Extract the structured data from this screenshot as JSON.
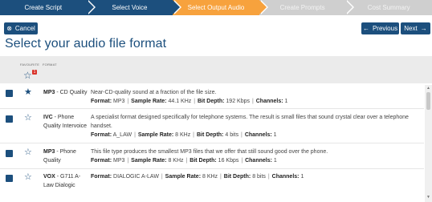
{
  "wizard": {
    "steps": [
      {
        "label": "Create Script",
        "state": "done"
      },
      {
        "label": "Select Voice",
        "state": "done"
      },
      {
        "label": "Select Output Audio",
        "state": "active"
      },
      {
        "label": "Create Prompts",
        "state": "todo"
      },
      {
        "label": "Cost Summary",
        "state": "todo"
      }
    ]
  },
  "toolbar": {
    "cancel_label": "Cancel",
    "cancel_icon": "circle-x-icon",
    "previous_label": "Previous",
    "previous_icon": "arrow-left-icon",
    "next_label": "Next",
    "next_icon": "arrow-right-icon"
  },
  "page": {
    "title": "Select your audio file format"
  },
  "table": {
    "col_favourite": "FAVOURITE",
    "col_format": "FORMAT",
    "filter_badge": "1",
    "rows": [
      {
        "name": "MP3",
        "subtitle": " - CD Quality",
        "favourite": true,
        "description": "Near-CD-quality sound at a fraction of the file size.",
        "format_label": "Format:",
        "format": "MP3",
        "rate_label": "Sample Rate:",
        "rate": "44.1 KHz",
        "depth_label": "Bit Depth:",
        "depth": "192 Kbps",
        "channels_label": "Channels:",
        "channels": "1"
      },
      {
        "name": "IVC",
        "subtitle": " - Phone Quality Intervoice",
        "favourite": false,
        "description": "A specialist format designed specifically for telephone systems. The result is small files that sound crystal clear over a telephone handset.",
        "format_label": "Format:",
        "format": "A_LAW",
        "rate_label": "Sample Rate:",
        "rate": "8 KHz",
        "depth_label": "Bit Depth:",
        "depth": "4 bits",
        "channels_label": "Channels:",
        "channels": "1"
      },
      {
        "name": "MP3",
        "subtitle": " - Phone Quality",
        "favourite": false,
        "description": "This file type produces the smallest MP3 files that we offer that still sound good over the phone.",
        "format_label": "Format:",
        "format": "MP3",
        "rate_label": "Sample Rate:",
        "rate": "8 KHz",
        "depth_label": "Bit Depth:",
        "depth": "16 Kbps",
        "channels_label": "Channels:",
        "channels": "1"
      },
      {
        "name": "VOX",
        "subtitle": " - G711 A-Law Dialogic",
        "favourite": false,
        "description": "",
        "format_label": "Format:",
        "format": "DIALOGIC A-LAW",
        "rate_label": "Sample Rate:",
        "rate": "8 KHz",
        "depth_label": "Bit Depth:",
        "depth": "8 bits",
        "channels_label": "Channels:",
        "channels": "1"
      }
    ]
  },
  "colors": {
    "primary": "#1c4f7d",
    "accent": "#f7a23d",
    "inactive": "#cfcfcf",
    "badge": "#d9342b"
  }
}
